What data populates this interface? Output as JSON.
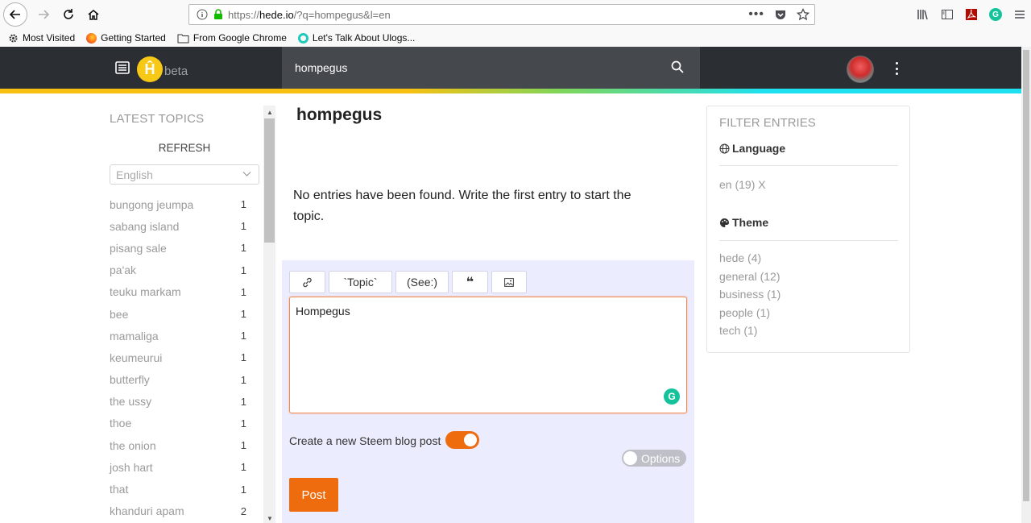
{
  "browser": {
    "url_prefix": "https://",
    "url_domain": "hede.io",
    "url_rest": "/?q=hompegus&l=en",
    "bookmarks": [
      "Most Visited",
      "Getting Started",
      "From Google Chrome",
      "Let's Talk About Ulogs..."
    ]
  },
  "header": {
    "logo_letter": "Ĥ",
    "beta_label": "beta",
    "search_value": "hompegus"
  },
  "sidebar": {
    "title": "LATEST TOPICS",
    "refresh_label": "REFRESH",
    "language_select": "English",
    "topics": [
      {
        "name": "bungong jeumpa",
        "count": "1"
      },
      {
        "name": "sabang island",
        "count": "1"
      },
      {
        "name": "pisang sale",
        "count": "1"
      },
      {
        "name": "pa'ak",
        "count": "1"
      },
      {
        "name": "teuku markam",
        "count": "1"
      },
      {
        "name": "bee",
        "count": "1"
      },
      {
        "name": "mamaliga",
        "count": "1"
      },
      {
        "name": "keumeurui",
        "count": "1"
      },
      {
        "name": "butterfly",
        "count": "1"
      },
      {
        "name": "the ussy",
        "count": "1"
      },
      {
        "name": "thoe",
        "count": "1"
      },
      {
        "name": "the onion",
        "count": "1"
      },
      {
        "name": "josh hart",
        "count": "1"
      },
      {
        "name": "that",
        "count": "1"
      },
      {
        "name": "khanduri apam",
        "count": "2"
      }
    ]
  },
  "main": {
    "title": "hompegus",
    "empty_message": "No entries have been found. Write the first entry to start the topic.",
    "toolbar": {
      "topic_label": "`Topic`",
      "see_label": "(See:)",
      "quote_label": "❝"
    },
    "entry_text": "Hompegus",
    "steem_label": "Create a new Steem blog post",
    "options_label": "Options",
    "post_label": "Post"
  },
  "filter": {
    "title": "FILTER ENTRIES",
    "language_heading": "Language",
    "language_entry": "en (19) X",
    "theme_heading": "Theme",
    "themes": [
      "hede (4)",
      "general (12)",
      "business (1)",
      "people (1)",
      "tech (1)"
    ]
  }
}
